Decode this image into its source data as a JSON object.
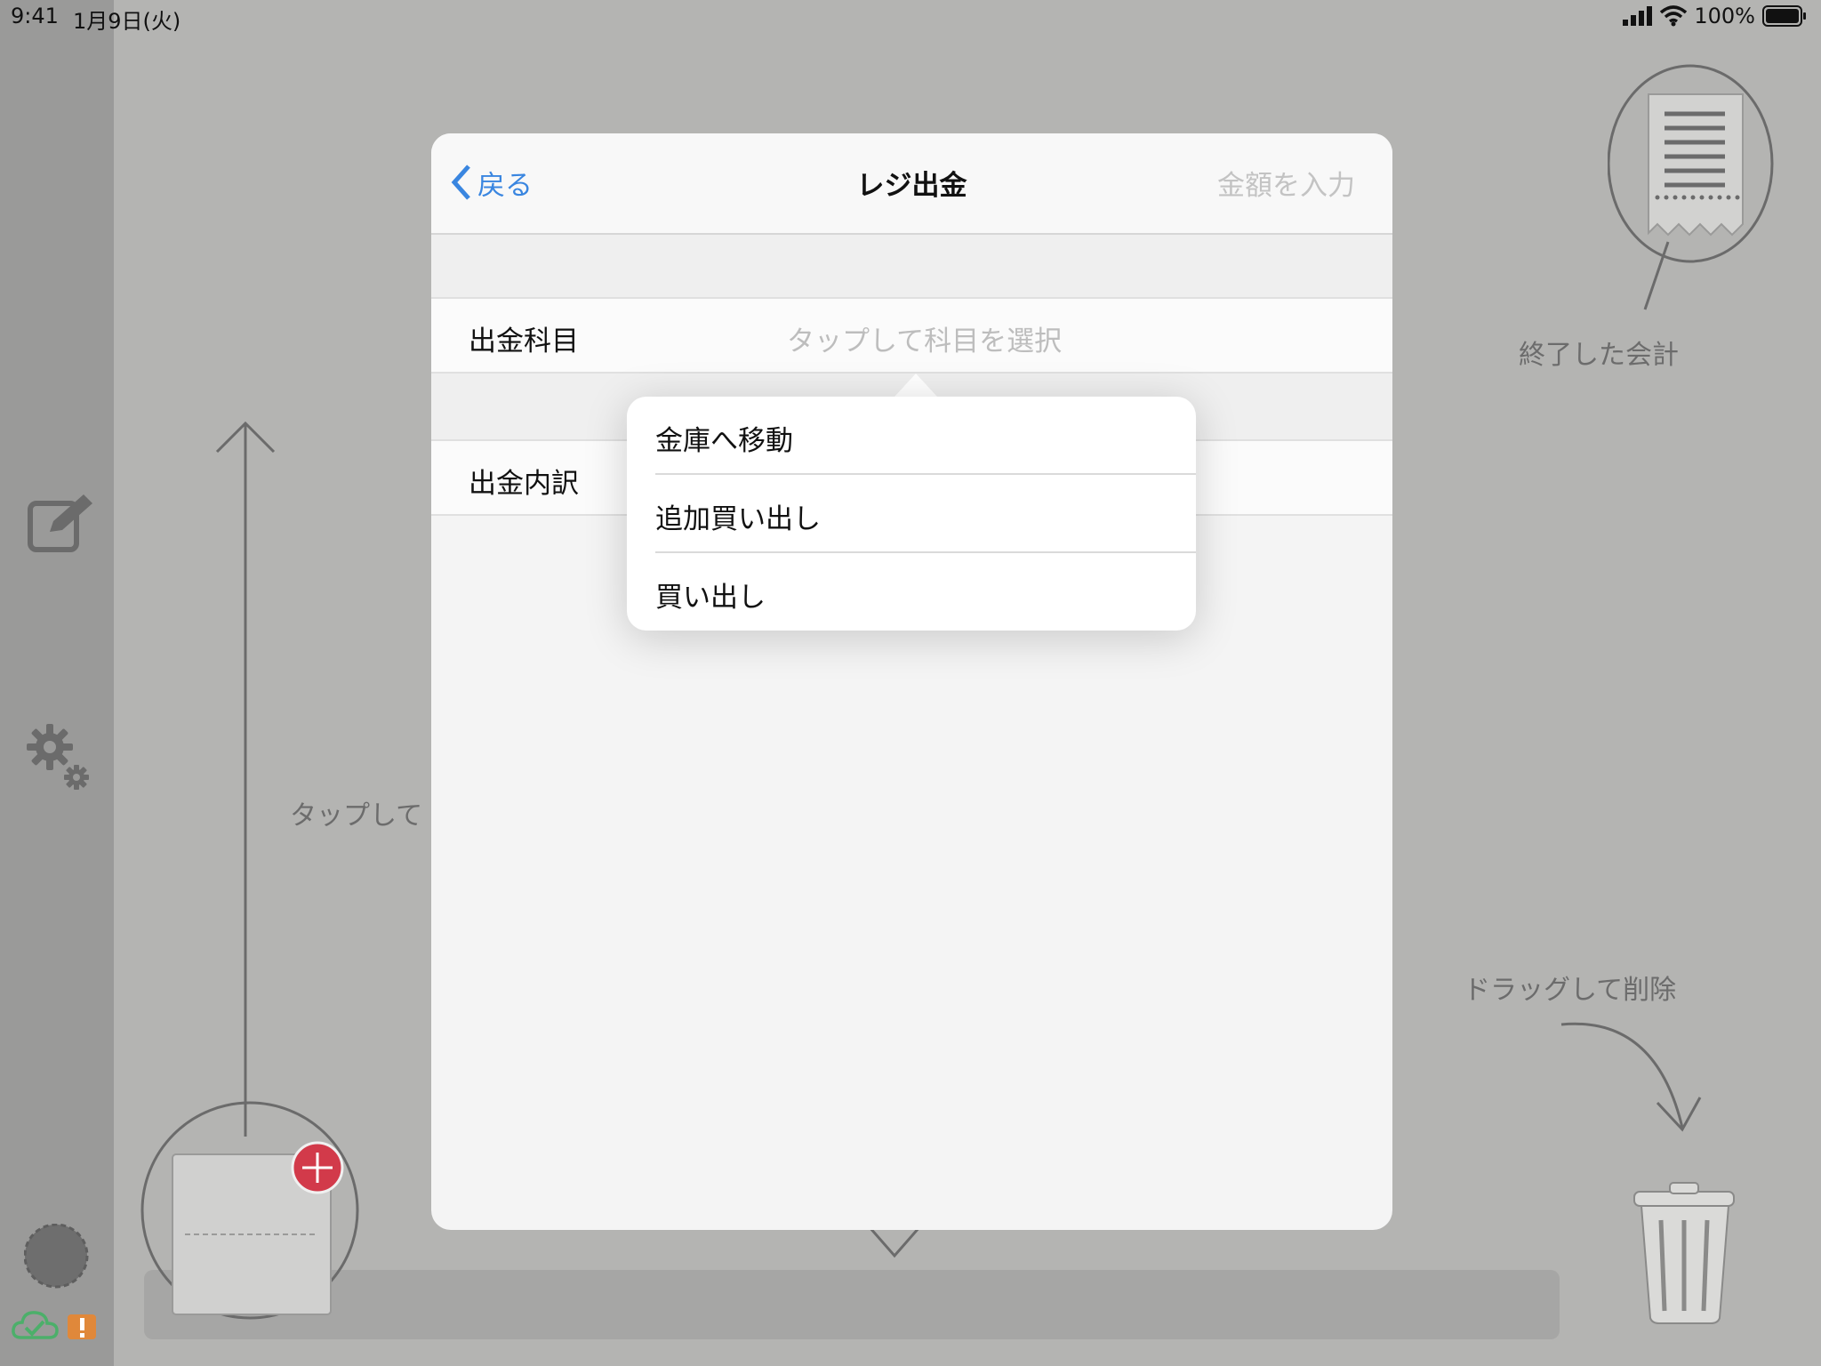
{
  "status_bar": {
    "time": "9:41",
    "date": "1月9日(火)",
    "battery": "100%"
  },
  "background": {
    "finished_label": "終了した会計",
    "tap_hint": "タップして",
    "drag_hint": "ドラッグして削除"
  },
  "modal": {
    "back_label": "戻る",
    "title": "レジ出金",
    "amount_placeholder": "金額を入力",
    "rows": [
      {
        "label": "出金科目",
        "value": "タップして科目を選択"
      },
      {
        "label": "出金内訳",
        "value": ""
      }
    ]
  },
  "popover": {
    "items": [
      {
        "label": "金庫へ移動"
      },
      {
        "label": "追加買い出し"
      },
      {
        "label": "買い出し"
      }
    ]
  },
  "colors": {
    "accent": "#3a86e0",
    "add_badge": "#d23a4a",
    "sync_ok": "#4caf6a",
    "warning": "#e0883a"
  }
}
